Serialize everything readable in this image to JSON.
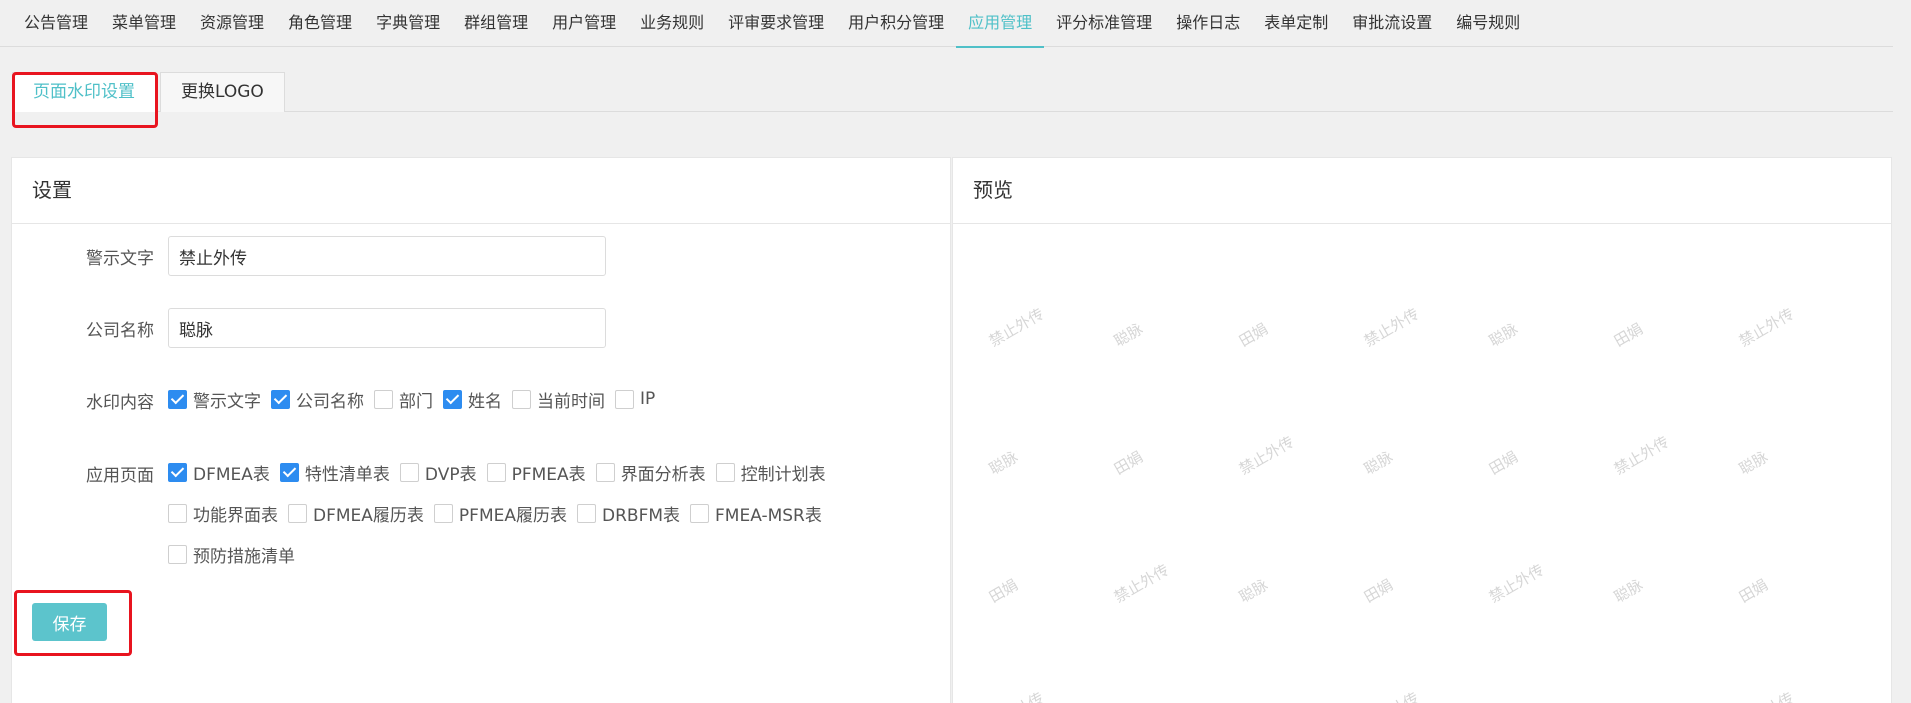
{
  "nav": {
    "items": [
      "公告管理",
      "菜单管理",
      "资源管理",
      "角色管理",
      "字典管理",
      "群组管理",
      "用户管理",
      "业务规则",
      "评审要求管理",
      "用户积分管理",
      "应用管理",
      "评分标准管理",
      "操作日志",
      "表单定制",
      "审批流设置",
      "编号规则"
    ],
    "active_index": 10
  },
  "subtabs": {
    "watermark": "页面水印设置",
    "logo": "更换LOGO"
  },
  "settings": {
    "title": "设置",
    "warning_label": "警示文字",
    "warning_value": "禁止外传",
    "company_label": "公司名称",
    "company_value": "聪脉",
    "content_label": "水印内容",
    "content_options": [
      {
        "label": "警示文字",
        "checked": true
      },
      {
        "label": "公司名称",
        "checked": true
      },
      {
        "label": "部门",
        "checked": false
      },
      {
        "label": "姓名",
        "checked": true
      },
      {
        "label": "当前时间",
        "checked": false
      },
      {
        "label": "IP",
        "checked": false
      }
    ],
    "pages_label": "应用页面",
    "page_options": [
      {
        "label": "DFMEA表",
        "checked": true
      },
      {
        "label": "特性清单表",
        "checked": true
      },
      {
        "label": "DVP表",
        "checked": false
      },
      {
        "label": "PFMEA表",
        "checked": false
      },
      {
        "label": "界面分析表",
        "checked": false
      },
      {
        "label": "控制计划表",
        "checked": false
      },
      {
        "label": "功能界面表",
        "checked": false
      },
      {
        "label": "DFMEA履历表",
        "checked": false
      },
      {
        "label": "PFMEA履历表",
        "checked": false
      },
      {
        "label": "DRBFM表",
        "checked": false
      },
      {
        "label": "FMEA-MSR表",
        "checked": false
      },
      {
        "label": "预防措施清单",
        "checked": false
      }
    ],
    "save_label": "保存"
  },
  "preview": {
    "title": "预览",
    "watermarks": [
      "禁止外传",
      "聪脉",
      "田娟"
    ]
  },
  "colors": {
    "accent": "#4fc0c8",
    "checkbox": "#2d8cf0",
    "highlight": "#e8141f"
  }
}
